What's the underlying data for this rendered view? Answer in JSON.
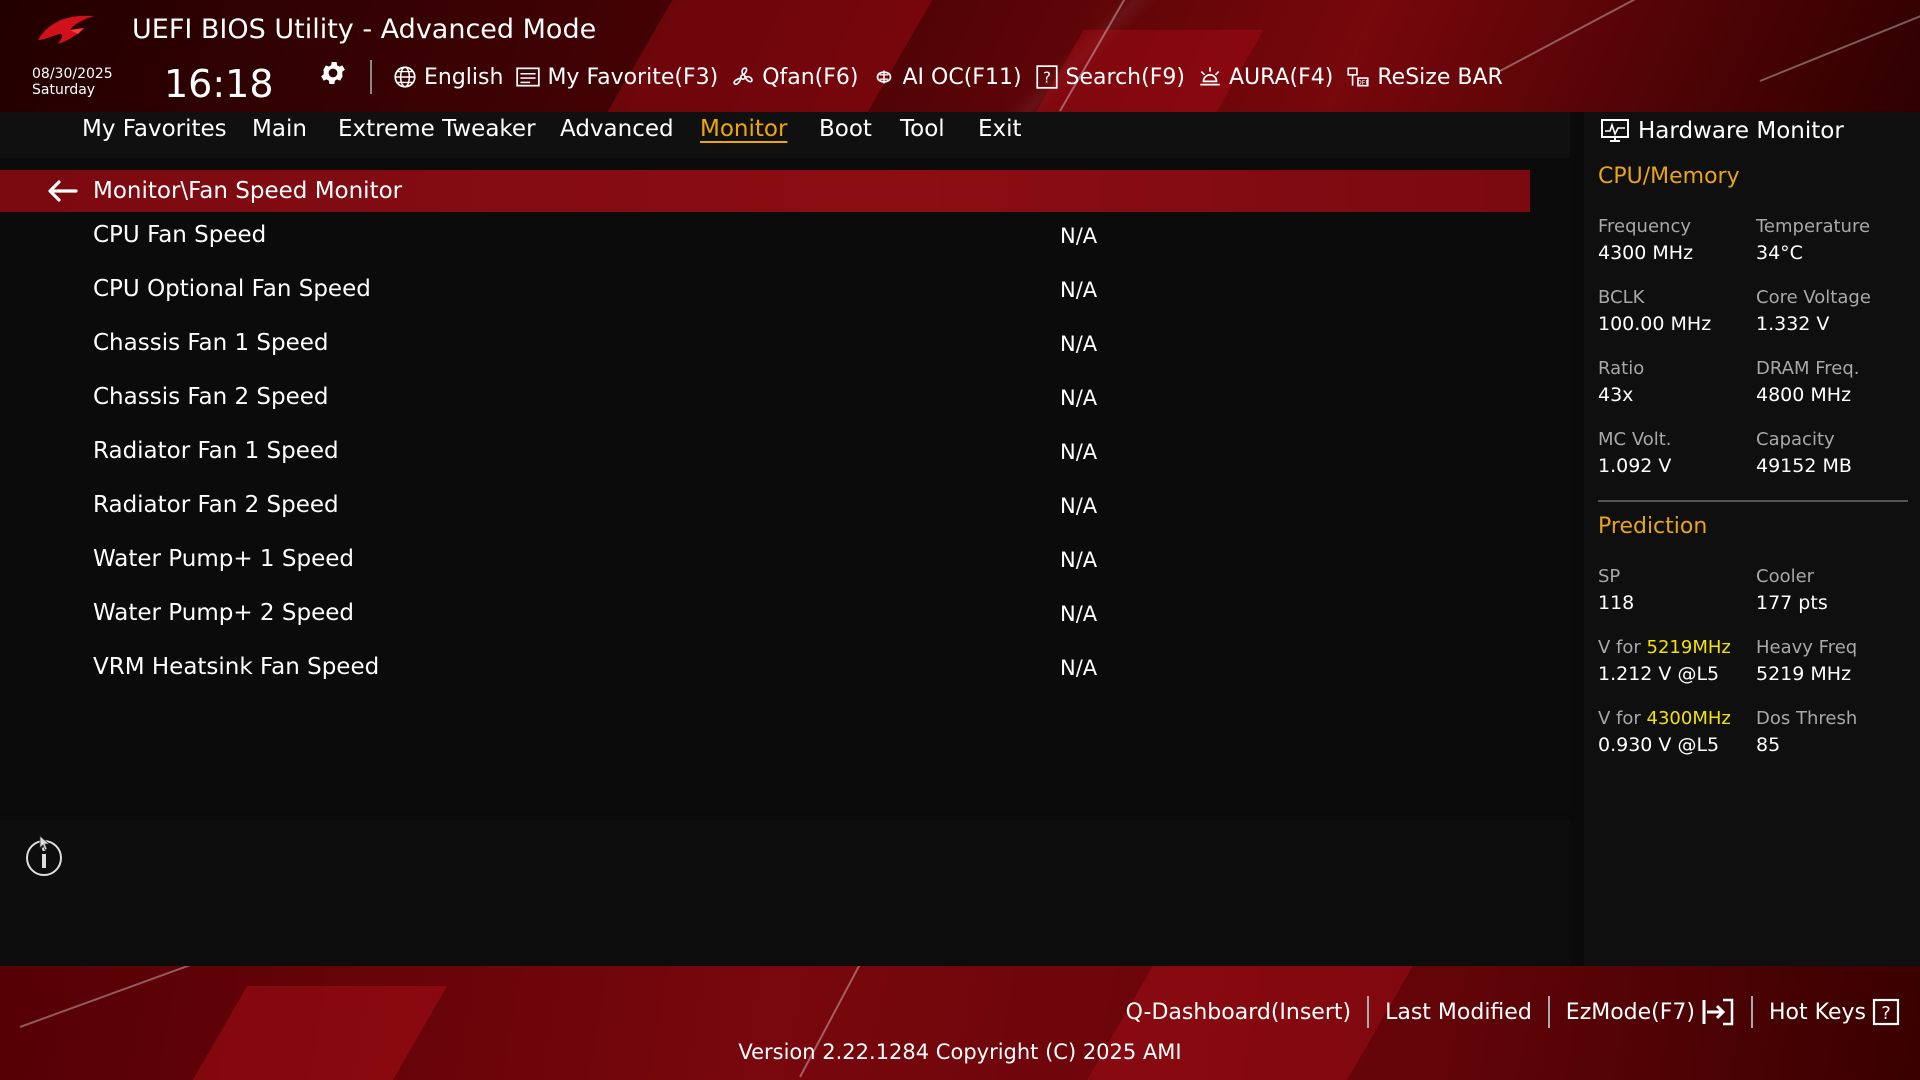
{
  "header": {
    "title": "UEFI BIOS Utility - Advanced Mode",
    "date": "08/30/2025",
    "day": "Saturday",
    "time": "16:18",
    "tools": [
      {
        "label": "English",
        "icon": "globe-icon"
      },
      {
        "label": "My Favorite(F3)",
        "icon": "favorite-list-icon"
      },
      {
        "label": "Qfan(F6)",
        "icon": "fan-icon"
      },
      {
        "label": "AI OC(F11)",
        "icon": "ai-chip-icon"
      },
      {
        "label": "Search(F9)",
        "icon": "help-search-icon"
      },
      {
        "label": "AURA(F4)",
        "icon": "aura-light-icon"
      },
      {
        "label": "ReSize BAR",
        "icon": "resize-bar-icon"
      }
    ]
  },
  "nav": {
    "items": [
      "My Favorites",
      "Main",
      "Extreme Tweaker",
      "Advanced",
      "Monitor",
      "Boot",
      "Tool",
      "Exit"
    ],
    "active": "Monitor"
  },
  "main": {
    "breadcrumb": "Monitor\\Fan Speed Monitor",
    "rows": [
      {
        "label": "CPU Fan Speed",
        "value": "N/A"
      },
      {
        "label": "CPU Optional Fan Speed",
        "value": "N/A"
      },
      {
        "label": "Chassis Fan 1 Speed",
        "value": "N/A"
      },
      {
        "label": "Chassis Fan 2 Speed",
        "value": "N/A"
      },
      {
        "label": "Radiator Fan 1 Speed",
        "value": "N/A"
      },
      {
        "label": "Radiator Fan 2 Speed",
        "value": "N/A"
      },
      {
        "label": "Water Pump+ 1 Speed",
        "value": "N/A"
      },
      {
        "label": "Water Pump+ 2 Speed",
        "value": "N/A"
      },
      {
        "label": "VRM Heatsink Fan Speed",
        "value": "N/A"
      }
    ]
  },
  "hardware_monitor": {
    "title": "Hardware Monitor",
    "cpu_memory": {
      "title": "CPU/Memory",
      "frequency_label": "Frequency",
      "frequency": "4300 MHz",
      "temperature_label": "Temperature",
      "temperature": "34°C",
      "bclk_label": "BCLK",
      "bclk": "100.00 MHz",
      "core_voltage_label": "Core Voltage",
      "core_voltage": "1.332 V",
      "ratio_label": "Ratio",
      "ratio": "43x",
      "dram_freq_label": "DRAM Freq.",
      "dram_freq": "4800 MHz",
      "mc_volt_label": "MC Volt.",
      "mc_volt": "1.092 V",
      "capacity_label": "Capacity",
      "capacity": "49152 MB"
    },
    "prediction": {
      "title": "Prediction",
      "sp_label": "SP",
      "sp": "118",
      "cooler_label": "Cooler",
      "cooler": "177 pts",
      "v_for_prefix": "V for",
      "v_for_1_freq": "5219MHz",
      "v_for_1": "1.212 V @L5",
      "heavy_freq_label": "Heavy Freq",
      "heavy_freq": "5219 MHz",
      "v_for_2_freq": "4300MHz",
      "v_for_2": "0.930 V @L5",
      "dos_thresh_label": "Dos Thresh",
      "dos_thresh": "85"
    }
  },
  "footer": {
    "qdashboard": "Q-Dashboard(Insert)",
    "last_modified": "Last Modified",
    "ezmode": "EzMode(F7)",
    "hotkeys": "Hot Keys",
    "version": "Version 2.22.1284 Copyright (C) 2025 AMI"
  },
  "colors": {
    "accent_gold": "#e8a317",
    "highlight_yellow": "#f2e200",
    "breadcrumb_red": "#8c0d14",
    "active_nav": "#f0a800"
  }
}
